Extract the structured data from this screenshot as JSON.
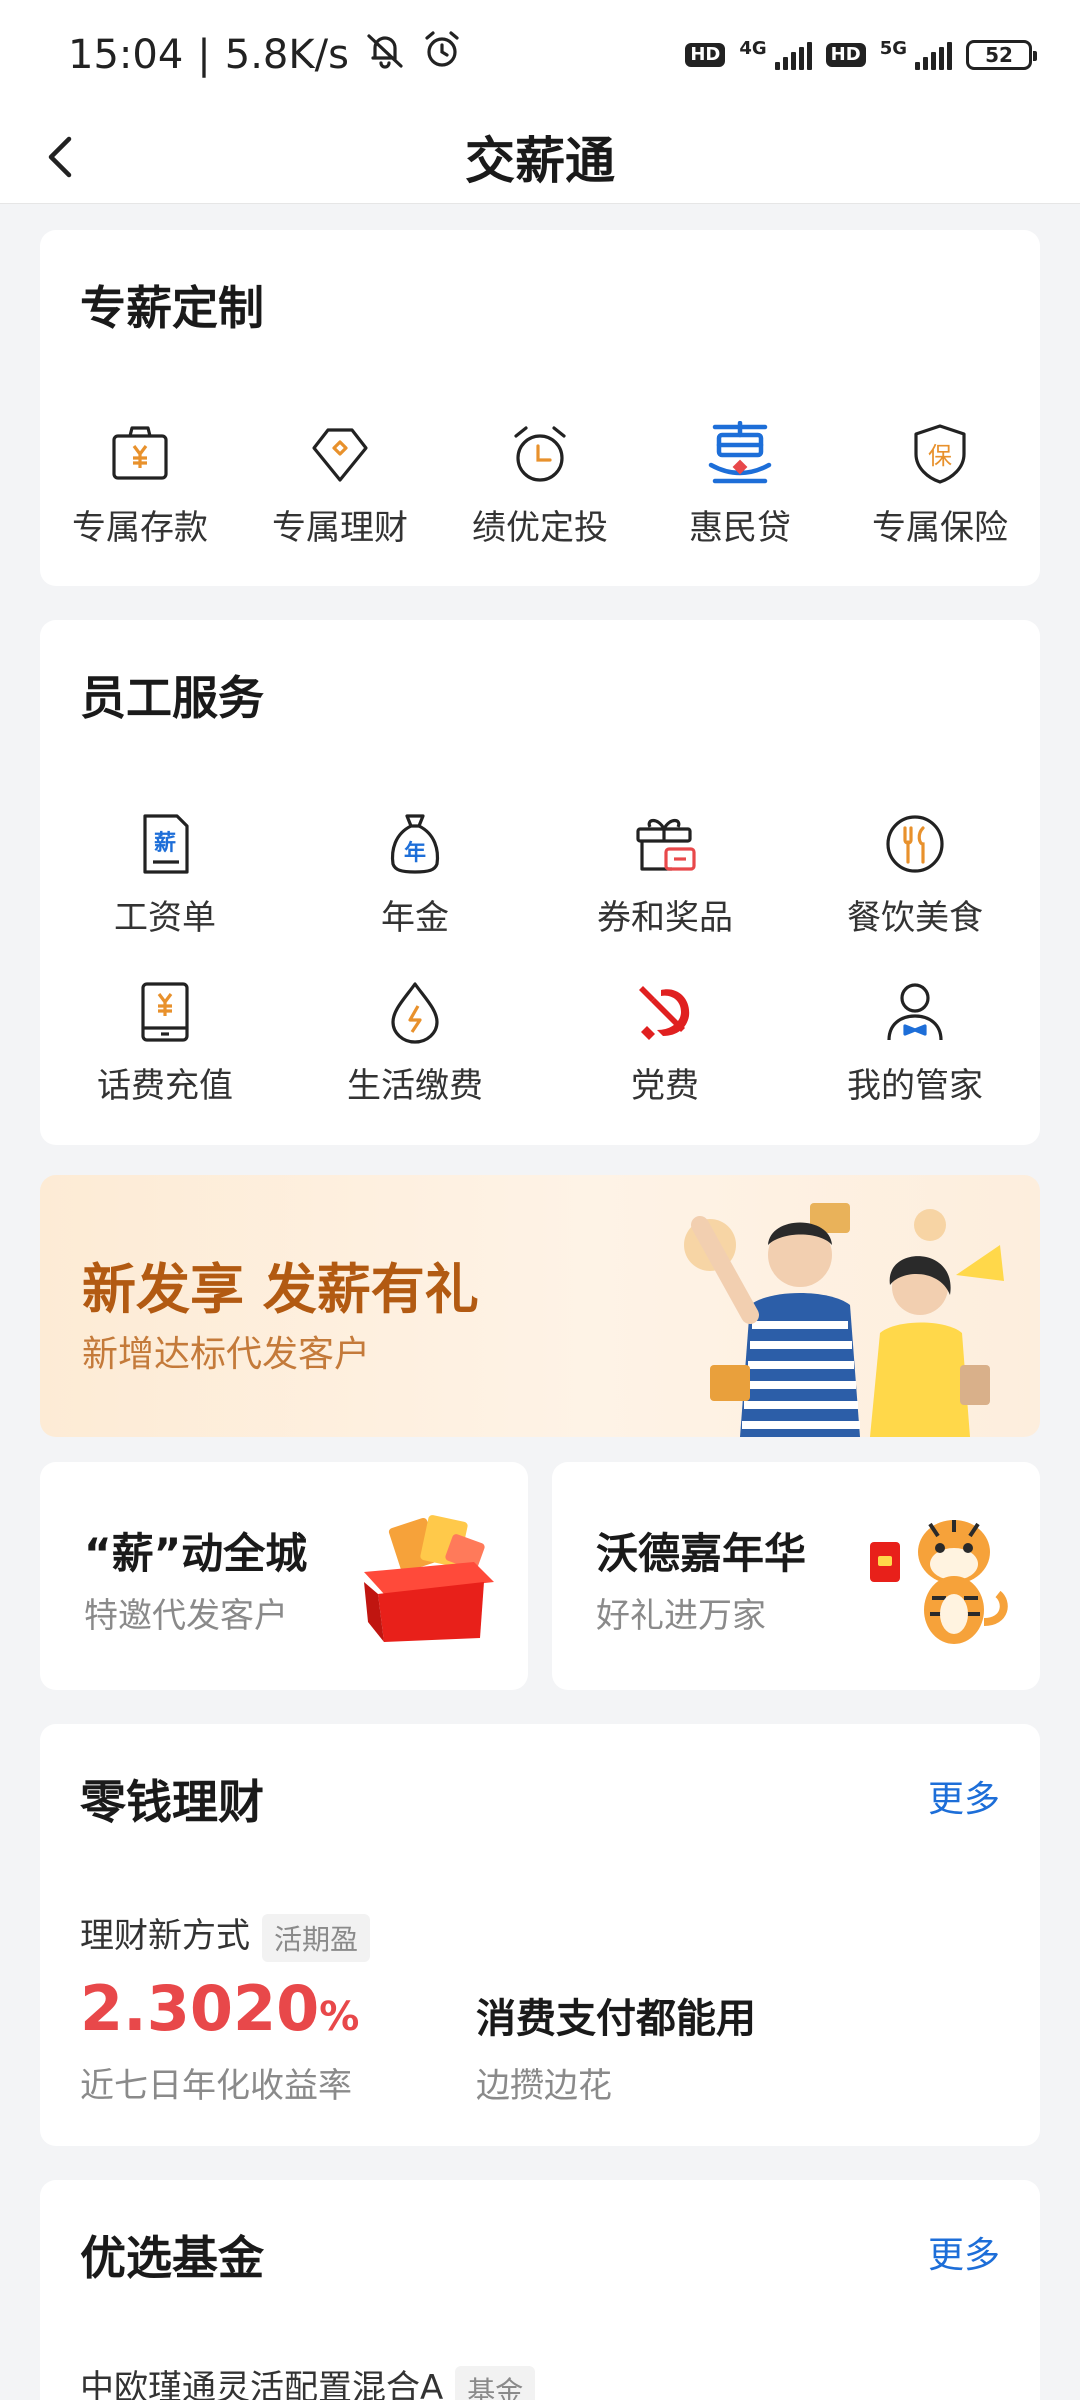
{
  "status_bar": {
    "time": "15:04",
    "speed": "5.8K/s",
    "sim1_network": "4G",
    "sim2_network": "5G",
    "hd": "HD",
    "battery": "52",
    "icons": [
      "mute-bell-icon",
      "alarm-icon",
      "signal-icon",
      "battery-icon"
    ]
  },
  "nav": {
    "title": "交薪通",
    "back_icon": "chevron-left-icon"
  },
  "custom_salary": {
    "title": "专薪定制",
    "items": [
      {
        "label": "专属存款",
        "icon": "wallet-yuan-icon"
      },
      {
        "label": "专属理财",
        "icon": "diamond-icon"
      },
      {
        "label": "绩优定投",
        "icon": "alarm-clock-icon"
      },
      {
        "label": "惠民贷",
        "icon": "huimin-loan-icon"
      },
      {
        "label": "专属保险",
        "icon": "insurance-shield-icon"
      }
    ]
  },
  "employee_services": {
    "title": "员工服务",
    "items": [
      {
        "label": "工资单",
        "icon": "payslip-icon"
      },
      {
        "label": "年金",
        "icon": "annuity-bag-icon"
      },
      {
        "label": "券和奖品",
        "icon": "gift-coupon-icon"
      },
      {
        "label": "餐饮美食",
        "icon": "dining-icon"
      },
      {
        "label": "话费充值",
        "icon": "phone-topup-icon"
      },
      {
        "label": "生活缴费",
        "icon": "utility-drop-icon"
      },
      {
        "label": "党费",
        "icon": "party-emblem-icon"
      },
      {
        "label": "我的管家",
        "icon": "butler-icon"
      }
    ]
  },
  "banner": {
    "title": "新发享 发薪有礼",
    "subtitle": "新增达标代发客户"
  },
  "promos": [
    {
      "title": "“薪”动全城",
      "subtitle": "特邀代发客户"
    },
    {
      "title": "沃德嘉年华",
      "subtitle": "好礼进万家"
    }
  ],
  "wealth": {
    "title": "零钱理财",
    "more": "更多",
    "product_label": "理财新方式",
    "product_tag": "活期盈",
    "rate_value": "2.3020",
    "rate_unit": "%",
    "rate_desc": "近七日年化收益率",
    "feature_title": "消费支付都能用",
    "feature_desc": "边攒边花"
  },
  "funds": {
    "title": "优选基金",
    "more": "更多",
    "first_fund_name": "中欧瑾通灵活配置混合A",
    "first_fund_tag": "基金"
  },
  "colors": {
    "accent_blue": "#1d6ed8",
    "rate_red": "#e8484a",
    "banner_brown": "#b25a12",
    "icon_orange": "#e8912c"
  }
}
